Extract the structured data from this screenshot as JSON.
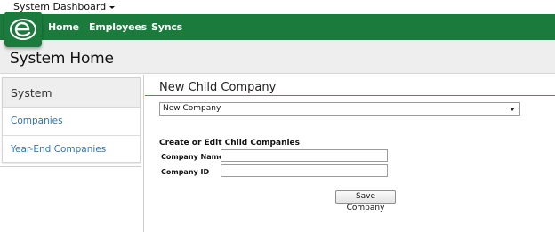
{
  "topbar": {
    "dashboard_menu": "System Dashboard"
  },
  "nav": {
    "items": [
      {
        "label": "Home"
      },
      {
        "label": "Employees"
      },
      {
        "label": "Syncs"
      }
    ]
  },
  "page": {
    "title": "System Home"
  },
  "sidebar": {
    "heading": "System",
    "items": [
      {
        "label": "Companies"
      },
      {
        "label": "Year-End Companies"
      }
    ]
  },
  "main": {
    "section_title": "New Child Company",
    "company_select": {
      "selected": "New Company"
    },
    "form": {
      "heading": "Create or Edit Child Companies",
      "company_name_label": "Company Name",
      "company_name_value": "",
      "company_id_label": "Company ID",
      "company_id_value": "",
      "save_label": "Save Company"
    }
  },
  "colors": {
    "nav_green": "#1b7b3c",
    "link_blue": "#2a78bd",
    "section_rule_blue": "#3f7fc6"
  },
  "icons": {
    "logo": "company-logo-icon",
    "dropdown": "caret-down-icon"
  }
}
